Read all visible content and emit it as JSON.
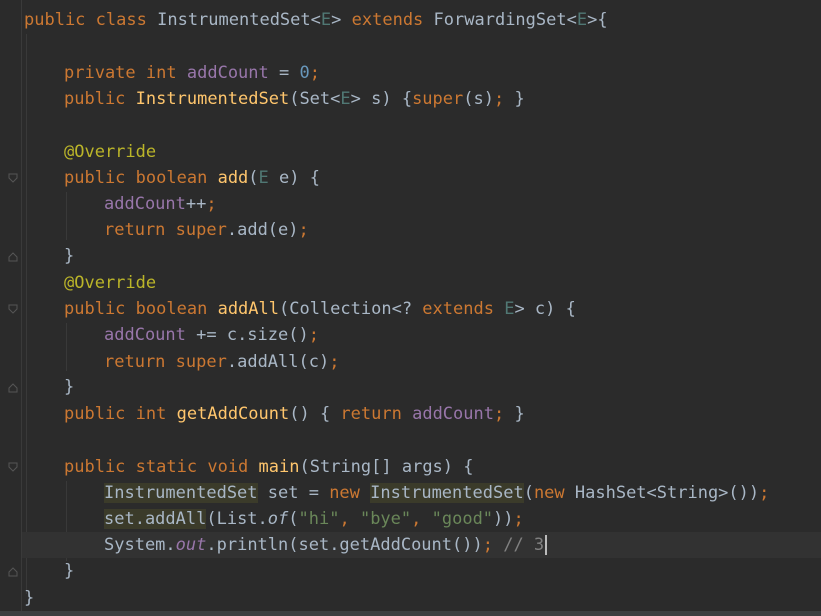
{
  "editor": {
    "lines": {
      "l1": {
        "a": "public",
        "b": "class",
        "c": "InstrumentedSet",
        "d": "<",
        "e": "E",
        "f": ">",
        "g": "extends",
        "h": "ForwardingSet",
        "i": "<",
        "j": "E",
        "k": ">{"
      },
      "l2": {
        "a": "private",
        "b": "int",
        "c": "addCount",
        "d": " = ",
        "e": "0",
        "f": ";"
      },
      "l3": {
        "a": "public",
        "b": "InstrumentedSet",
        "c": "(Set<",
        "d": "E",
        "e": "> s) {",
        "f": "super",
        "g": "(s)",
        "h": ";",
        "i": " }"
      },
      "l4": {
        "a": "@Override"
      },
      "l5": {
        "a": "public",
        "b": "boolean",
        "c": "add",
        "d": "(",
        "e": "E",
        "f": " e) {"
      },
      "l6": {
        "a": "addCount",
        "b": "++",
        "c": ";"
      },
      "l7": {
        "a": "return",
        "b": "super",
        "c": ".add(e)",
        "d": ";"
      },
      "l8": {
        "a": "}"
      },
      "l9": {
        "a": "@Override"
      },
      "l10": {
        "a": "public",
        "b": "boolean",
        "c": "addAll",
        "d": "(Collection<? ",
        "e": "extends",
        "f": "E",
        "g": "> c) {"
      },
      "l11": {
        "a": "addCount",
        "b": " += c.size()",
        "c": ";"
      },
      "l12": {
        "a": "return",
        "b": "super",
        "c": ".addAll(c)",
        "d": ";"
      },
      "l13": {
        "a": "}"
      },
      "l14": {
        "a": "public",
        "b": "int",
        "c": "getAddCount",
        "d": "() { ",
        "e": "return",
        "f": "addCount",
        "g": ";",
        "h": " }"
      },
      "l15": {
        "a": "public",
        "b": "static",
        "c": "void",
        "d": "main",
        "e": "(String[] args) {"
      },
      "l16": {
        "a": "InstrumentedSet",
        "b": " set = ",
        "c": "new",
        "d": "InstrumentedSet",
        "e": "(",
        "f": "new",
        "g": " HashSet<String>())",
        "h": ";"
      },
      "l17": {
        "a": "set.addAll",
        "b": "(List.",
        "c": "of",
        "d": "(",
        "e": "\"hi\"",
        "f": ", ",
        "g": "\"bye\"",
        "h": ", ",
        "i": "\"good\"",
        "j": "))",
        "k": ";"
      },
      "l18": {
        "a": "System.",
        "b": "out",
        "c": ".println(set.getAddCount())",
        "d": ";",
        "e": " // 3"
      },
      "l19": {
        "a": "}"
      },
      "l20": {
        "a": "}"
      }
    },
    "colors": {
      "background": "#2b2b2b",
      "keyword": "#cc7832",
      "function": "#ffc66d",
      "field": "#9876aa",
      "number": "#6897bb",
      "string": "#6a8759",
      "annotation": "#bbb529",
      "type_param": "#507874",
      "comment": "#808080",
      "text": "#a9b7c6"
    }
  }
}
